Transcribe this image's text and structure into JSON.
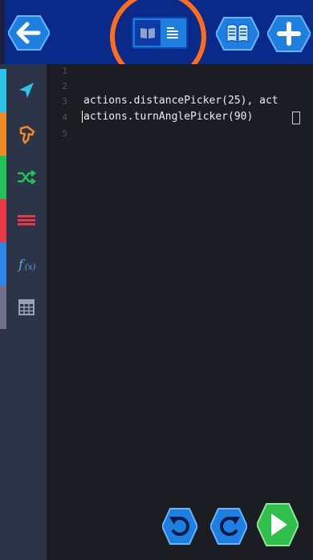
{
  "toolbar": {
    "back_icon": "arrow-left-icon",
    "view_toggle": {
      "left_icon": "book-icon",
      "right_icon": "lines-icon",
      "active": "text"
    },
    "tutorial_icon": "open-book-icon",
    "add_icon": "plus-icon"
  },
  "sidebar": {
    "categories": [
      {
        "id": "motion",
        "icon": "navigation-arrow-icon",
        "color": "#2ec4e8"
      },
      {
        "id": "actions",
        "icon": "hand-pointer-icon",
        "color": "#f08a26"
      },
      {
        "id": "control",
        "icon": "shuffle-icon",
        "color": "#23c05a"
      },
      {
        "id": "lists",
        "icon": "stack-lines-icon",
        "color": "#e8394a"
      },
      {
        "id": "functions",
        "icon": "function-icon",
        "color": "#2c86e8"
      },
      {
        "id": "math",
        "icon": "calculator-icon",
        "color": "#6f6f8c"
      }
    ]
  },
  "editor": {
    "lines": [
      {
        "number": "1",
        "code": ""
      },
      {
        "number": "2",
        "code": ""
      },
      {
        "number": "3",
        "code": "actions.distancePicker(25), act"
      },
      {
        "number": "4",
        "code": "actions.turnAnglePicker(90)"
      },
      {
        "number": "5",
        "code": ""
      }
    ]
  },
  "bottom": {
    "undo_icon": "undo-icon",
    "redo_icon": "redo-icon",
    "run_icon": "play-icon"
  },
  "colors": {
    "topbar": "#0a2a8a",
    "button_fill": "#1f7fe0",
    "highlight_ring": "#ff6d1c",
    "run_green": "#2fbf4a",
    "sidebar_bg": "#2c3447",
    "editor_bg": "#1b1d22"
  }
}
